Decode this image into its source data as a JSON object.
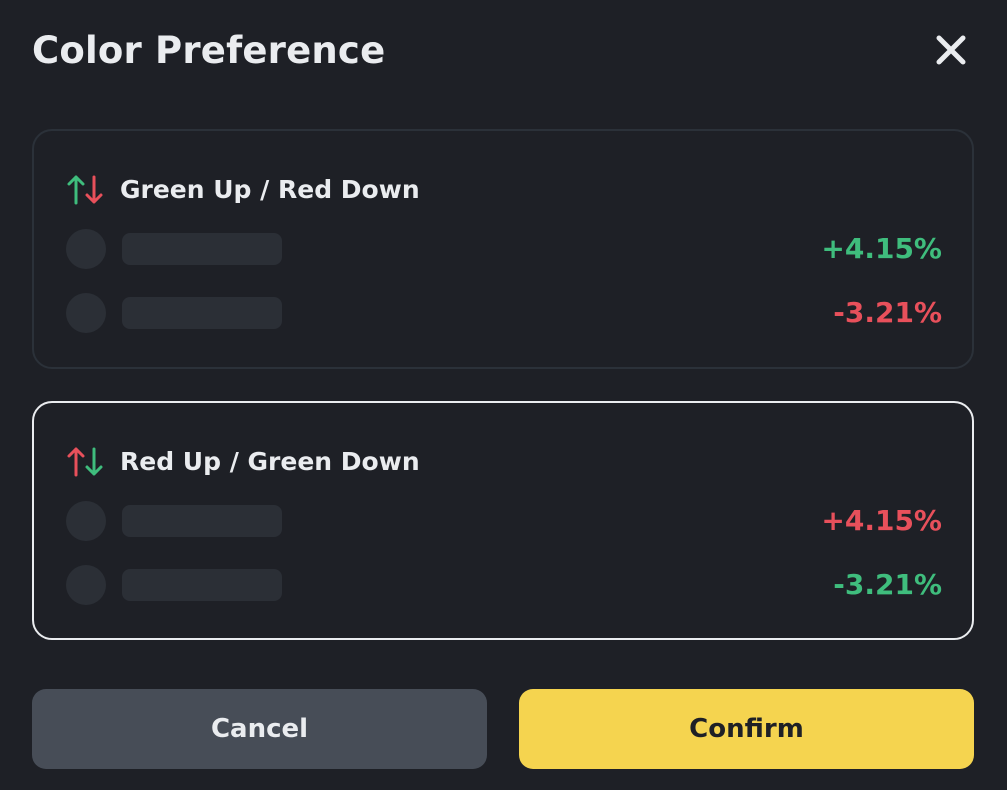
{
  "dialog": {
    "title": "Color Preference"
  },
  "colors": {
    "background": "#1e2026",
    "up_green": "#2ebd85",
    "down_red": "#f6465d",
    "selected_border": "#eaecef",
    "unselected_border": "#2b3139",
    "placeholder": "#2b2f36",
    "cancel_bg": "#474d57",
    "confirm_bg": "#f5d44f"
  },
  "options": [
    {
      "label": "Green Up / Red Down",
      "icon": "arrows-up-down-icon",
      "selected": false,
      "rows": [
        {
          "value": "+4.15%",
          "color": "#3fbd7d"
        },
        {
          "value": "-3.21%",
          "color": "#e8505b"
        }
      ]
    },
    {
      "label": "Red Up / Green Down",
      "icon": "arrows-up-down-icon",
      "selected": true,
      "rows": [
        {
          "value": "+4.15%",
          "color": "#e8505b"
        },
        {
          "value": "-3.21%",
          "color": "#3fbd7d"
        }
      ]
    }
  ],
  "buttons": {
    "cancel_label": "Cancel",
    "confirm_label": "Confirm"
  }
}
